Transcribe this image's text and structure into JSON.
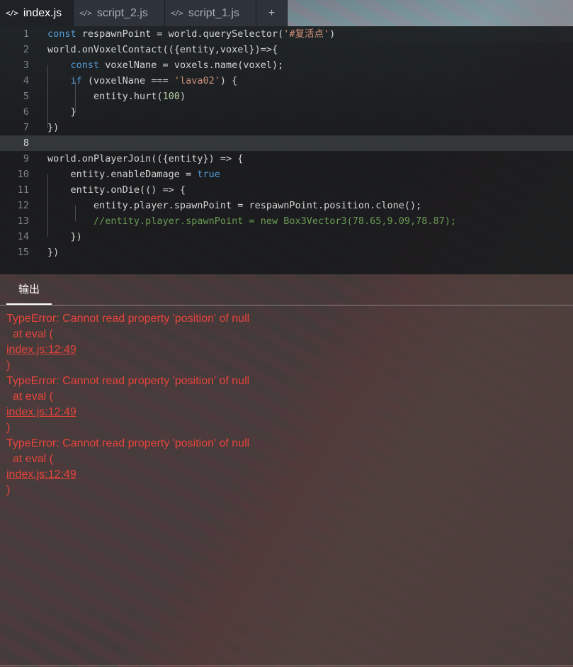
{
  "tabs": [
    {
      "label": "index.js",
      "icon": "code-icon",
      "active": true
    },
    {
      "label": "script_2.js",
      "icon": "code-icon",
      "active": false
    },
    {
      "label": "script_1.js",
      "icon": "code-icon",
      "active": false
    }
  ],
  "add_tab_label": "+",
  "editor": {
    "current_line": 8,
    "line_numbers": [
      "1",
      "2",
      "3",
      "4",
      "5",
      "6",
      "7",
      "8",
      "9",
      "10",
      "11",
      "12",
      "13",
      "14",
      "15"
    ],
    "lines": [
      "const respawnPoint = world.querySelector('#复活点')",
      "world.onVoxelContact(({entity,voxel})=>{",
      "    const voxelNane = voxels.name(voxel);",
      "    if (voxelNane === 'lava02') {",
      "        entity.hurt(100)",
      "    }",
      "})",
      "",
      "world.onPlayerJoin(({entity}) => {",
      "    entity.enableDamage = true",
      "    entity.onDie(() => {",
      "        entity.player.spawnPoint = respawnPoint.position.clone();",
      "        //entity.player.spawnPoint = new Box3Vector3(78.65,9.09,78.87);",
      "    })",
      "})"
    ]
  },
  "output": {
    "tab_label": "输出",
    "errors": [
      {
        "message": "TypeError: Cannot read property 'position' of null",
        "at": "at eval  (",
        "link": "index.js:12:49",
        "close": ")"
      },
      {
        "message": "TypeError: Cannot read property 'position' of null",
        "at": "at eval  (",
        "link": "index.js:12:49",
        "close": ")"
      },
      {
        "message": "TypeError: Cannot read property 'position' of null",
        "at": "at eval  (",
        "link": "index.js:12:49",
        "close": ")"
      }
    ]
  },
  "colors": {
    "error_red": "#e6443c",
    "keyword": "#569cd6",
    "string": "#ce9178",
    "number": "#b5cea8",
    "comment": "#6a9955"
  }
}
